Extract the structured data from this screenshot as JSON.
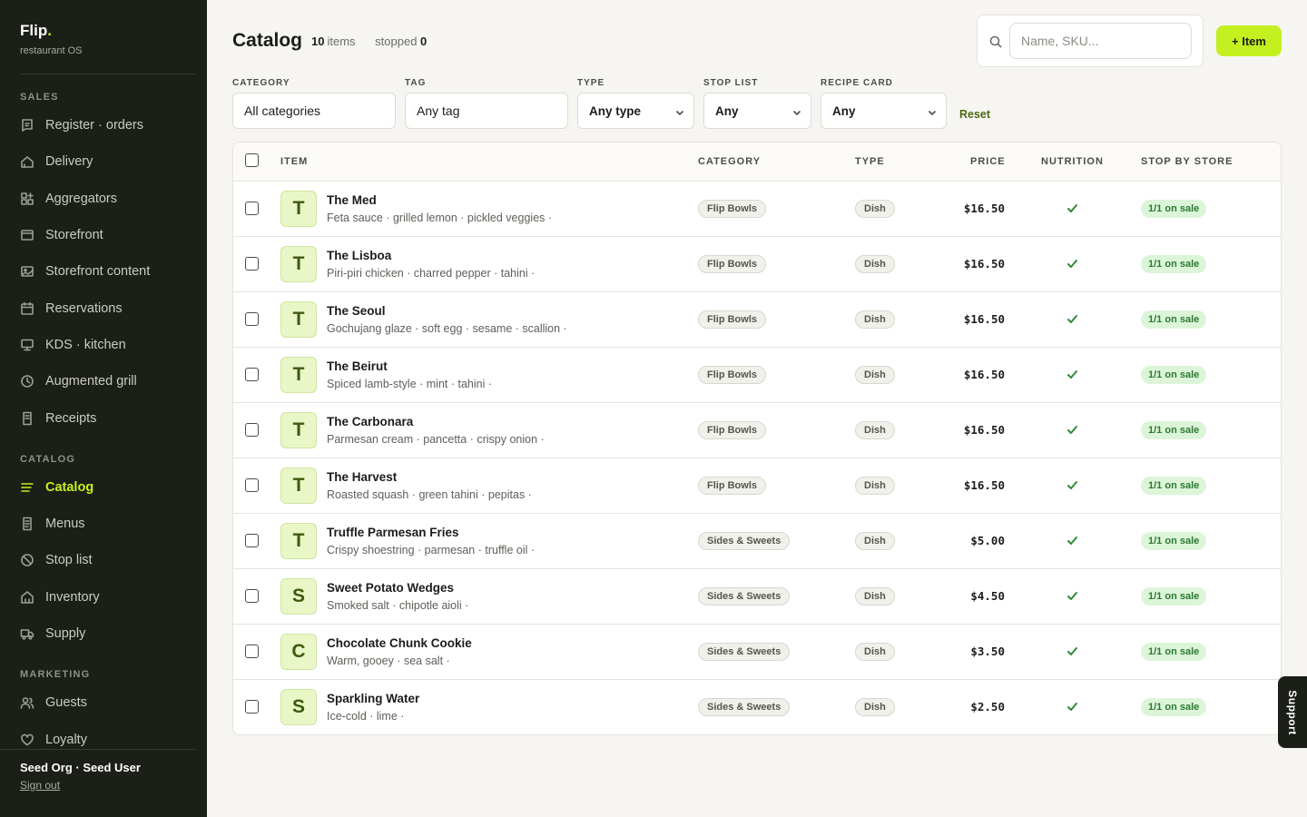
{
  "brand": {
    "name": "Flip",
    "dot": ".",
    "subtitle": "restaurant OS"
  },
  "sidebar": {
    "sections": [
      {
        "title": "SALES",
        "items": [
          {
            "label": "Register · orders",
            "icon": "register-icon"
          },
          {
            "label": "Delivery",
            "icon": "delivery-icon"
          },
          {
            "label": "Aggregators",
            "icon": "aggregators-icon"
          },
          {
            "label": "Storefront",
            "icon": "storefront-icon"
          },
          {
            "label": "Storefront content",
            "icon": "image-icon"
          },
          {
            "label": "Reservations",
            "icon": "calendar-icon"
          },
          {
            "label": "KDS · kitchen",
            "icon": "monitor-icon"
          },
          {
            "label": "Augmented grill",
            "icon": "clock-icon"
          },
          {
            "label": "Receipts",
            "icon": "receipt-icon"
          }
        ]
      },
      {
        "title": "CATALOG",
        "items": [
          {
            "label": "Catalog",
            "icon": "list-icon",
            "active": true
          },
          {
            "label": "Menus",
            "icon": "menu-book-icon"
          },
          {
            "label": "Stop list",
            "icon": "stop-icon"
          },
          {
            "label": "Inventory",
            "icon": "inventory-icon"
          },
          {
            "label": "Supply",
            "icon": "truck-icon"
          }
        ]
      },
      {
        "title": "MARKETING",
        "items": [
          {
            "label": "Guests",
            "icon": "users-icon"
          },
          {
            "label": "Loyalty",
            "icon": "heart-icon"
          }
        ]
      }
    ],
    "footer": {
      "user": "Seed Org · Seed User",
      "signout": "Sign out"
    }
  },
  "header": {
    "title": "Catalog",
    "items_count": "10",
    "items_label": "items",
    "stopped_label": "stopped",
    "stopped_count": "0",
    "search_placeholder": "Name, SKU...",
    "add_label": "+ Item"
  },
  "filters": {
    "category": {
      "label": "CATEGORY",
      "value": "All categories"
    },
    "tag": {
      "label": "TAG",
      "value": "Any tag"
    },
    "type": {
      "label": "TYPE",
      "value": "Any type"
    },
    "stop_list": {
      "label": "STOP LIST",
      "value": "Any"
    },
    "recipe_card": {
      "label": "RECIPE CARD",
      "value": "Any"
    },
    "reset": "Reset"
  },
  "table": {
    "columns": {
      "item": "ITEM",
      "category": "CATEGORY",
      "type": "TYPE",
      "price": "PRICE",
      "nutrition": "NUTRITION",
      "stop_by_store": "STOP BY STORE"
    },
    "rows": [
      {
        "initial": "T",
        "name": "The Med",
        "desc": "Feta sauce · grilled lemon · pickled veggies ·",
        "category": "Flip Bowls",
        "type": "Dish",
        "price": "$16.50",
        "nutrition": true,
        "stop": "1/1 on sale"
      },
      {
        "initial": "T",
        "name": "The Lisboa",
        "desc": "Piri-piri chicken · charred pepper · tahini ·",
        "category": "Flip Bowls",
        "type": "Dish",
        "price": "$16.50",
        "nutrition": true,
        "stop": "1/1 on sale"
      },
      {
        "initial": "T",
        "name": "The Seoul",
        "desc": "Gochujang glaze · soft egg · sesame · scallion ·",
        "category": "Flip Bowls",
        "type": "Dish",
        "price": "$16.50",
        "nutrition": true,
        "stop": "1/1 on sale"
      },
      {
        "initial": "T",
        "name": "The Beirut",
        "desc": "Spiced lamb-style · mint · tahini ·",
        "category": "Flip Bowls",
        "type": "Dish",
        "price": "$16.50",
        "nutrition": true,
        "stop": "1/1 on sale"
      },
      {
        "initial": "T",
        "name": "The Carbonara",
        "desc": "Parmesan cream · pancetta · crispy onion ·",
        "category": "Flip Bowls",
        "type": "Dish",
        "price": "$16.50",
        "nutrition": true,
        "stop": "1/1 on sale"
      },
      {
        "initial": "T",
        "name": "The Harvest",
        "desc": "Roasted squash · green tahini · pepitas ·",
        "category": "Flip Bowls",
        "type": "Dish",
        "price": "$16.50",
        "nutrition": true,
        "stop": "1/1 on sale"
      },
      {
        "initial": "T",
        "name": "Truffle Parmesan Fries",
        "desc": "Crispy shoestring · parmesan · truffle oil ·",
        "category": "Sides & Sweets",
        "type": "Dish",
        "price": "$5.00",
        "nutrition": true,
        "stop": "1/1 on sale"
      },
      {
        "initial": "S",
        "name": "Sweet Potato Wedges",
        "desc": "Smoked salt · chipotle aioli ·",
        "category": "Sides & Sweets",
        "type": "Dish",
        "price": "$4.50",
        "nutrition": true,
        "stop": "1/1 on sale"
      },
      {
        "initial": "C",
        "name": "Chocolate Chunk Cookie",
        "desc": "Warm, gooey · sea salt ·",
        "category": "Sides & Sweets",
        "type": "Dish",
        "price": "$3.50",
        "nutrition": true,
        "stop": "1/1 on sale"
      },
      {
        "initial": "S",
        "name": "Sparkling Water",
        "desc": "Ice-cold · lime ·",
        "category": "Sides & Sweets",
        "type": "Dish",
        "price": "$2.50",
        "nutrition": true,
        "stop": "1/1 on sale"
      }
    ]
  },
  "support": {
    "label": "Support"
  },
  "colors": {
    "accent": "#c5f01f",
    "sidebar_bg": "#1b1f17",
    "sale_bg": "#dcf5d8",
    "sale_text": "#2b7a33",
    "check": "#2e8a3a"
  }
}
